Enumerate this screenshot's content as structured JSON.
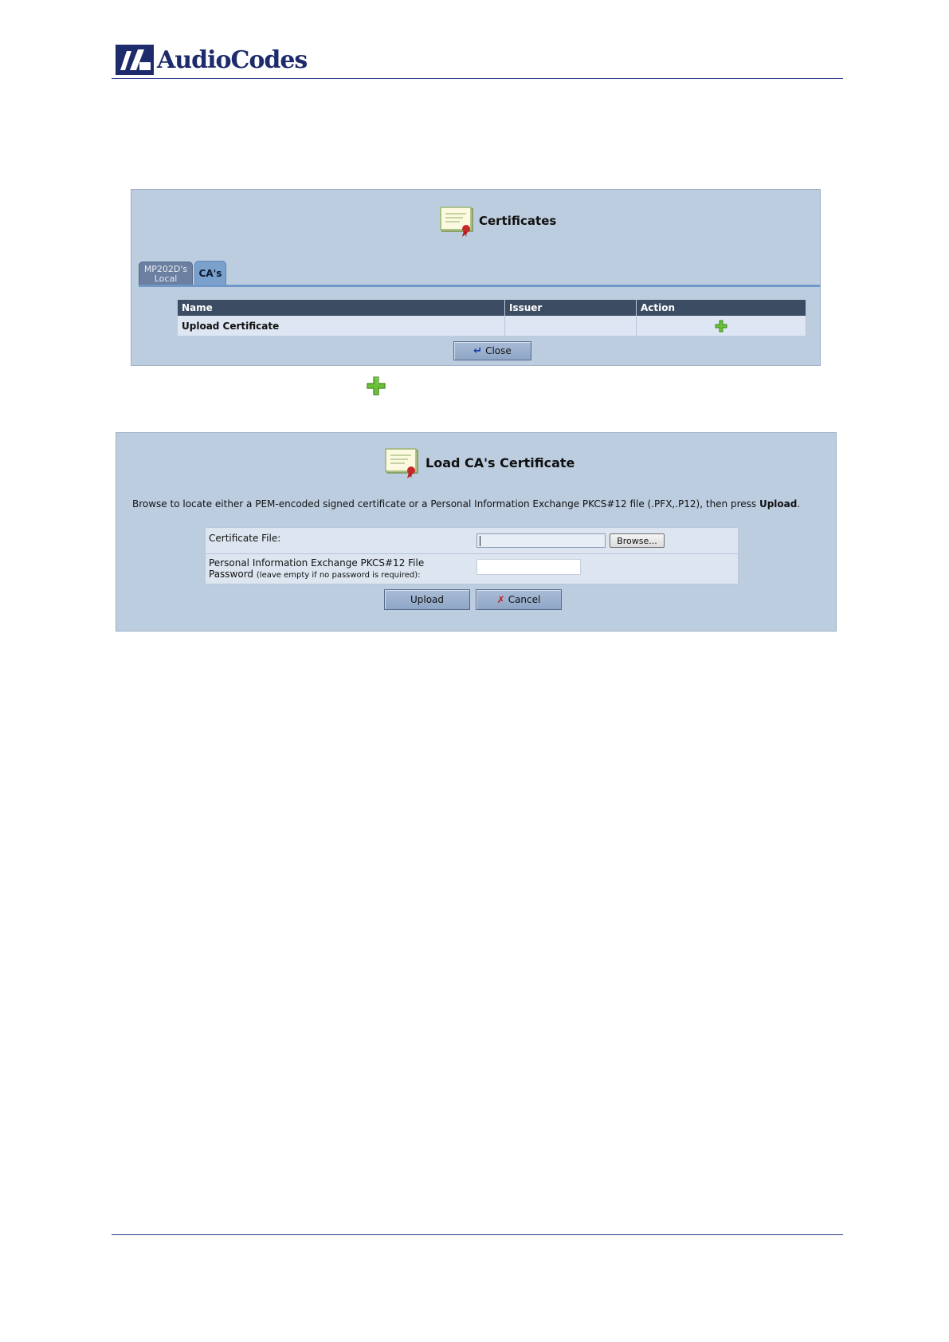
{
  "header": {
    "brand": "AudioCodes"
  },
  "certificates_panel": {
    "title": "Certificates",
    "tabs": [
      {
        "label_line1": "MP202D's",
        "label_line2": "Local",
        "active": false
      },
      {
        "label": "CA's",
        "active": true
      }
    ],
    "table": {
      "columns": [
        "Name",
        "Issuer",
        "Action"
      ],
      "rows": [
        {
          "name": "Upload Certificate",
          "issuer": "",
          "action_icon": "plus-icon"
        }
      ]
    },
    "close_label": "Close"
  },
  "standalone_icon": "plus-icon",
  "load_ca_panel": {
    "title": "Load CA's Certificate",
    "instruction_prefix": "Browse to locate either a PEM-encoded signed certificate or a Personal Information Exchange PKCS#12 file (.PFX,.P12), then press ",
    "instruction_bold": "Upload",
    "instruction_suffix": ".",
    "certificate_file_label": "Certificate File:",
    "certificate_file_value": "",
    "browse_label": "Browse...",
    "pkcs_label_line1": "Personal Information Exchange PKCS#12 File",
    "pkcs_label_line2": "Password",
    "pkcs_label_hint": "(leave empty if no password is required):",
    "password_value": "",
    "upload_label": "Upload",
    "cancel_label": "Cancel"
  },
  "colors": {
    "panel_bg": "#bccde0",
    "table_header": "#3b4c63",
    "brand_blue": "#1d2a6b",
    "plus_green": "#6cbf3a"
  }
}
